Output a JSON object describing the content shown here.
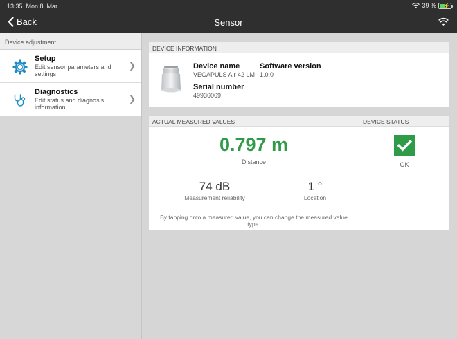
{
  "statusbar": {
    "time": "13:35",
    "date": "Mon 8. Mar",
    "battery": "39 %"
  },
  "navbar": {
    "back_label": "Back",
    "title": "Sensor"
  },
  "sidebar": {
    "header": "Device adjustment",
    "items": [
      {
        "title": "Setup",
        "subtitle": "Edit sensor parameters and settings",
        "icon": "gear-icon"
      },
      {
        "title": "Diagnostics",
        "subtitle": "Edit status and diagnosis information",
        "icon": "stethoscope-icon"
      }
    ]
  },
  "device_info": {
    "header": "DEVICE INFORMATION",
    "device_name_label": "Device name",
    "device_name_value": "VEGAPULS Air 42 LM",
    "software_version_label": "Software version",
    "software_version_value": "1.0.0",
    "serial_number_label": "Serial number",
    "serial_number_value": "49936069"
  },
  "measured": {
    "header": "ACTUAL MEASURED VALUES",
    "primary_value": "0.797 m",
    "primary_label": "Distance",
    "reliability_value": "74 dB",
    "reliability_label": "Measurement reliability",
    "location_value": "1 °",
    "location_label": "Location",
    "hint": "By tapping onto a measured value, you can change the measured value type."
  },
  "device_status": {
    "header": "DEVICE STATUS",
    "status_label": "OK",
    "status_color": "#2e9b48"
  },
  "colors": {
    "accent": "#1e8bc3",
    "ok": "#2e9b48",
    "bar": "#2f2f2f"
  }
}
